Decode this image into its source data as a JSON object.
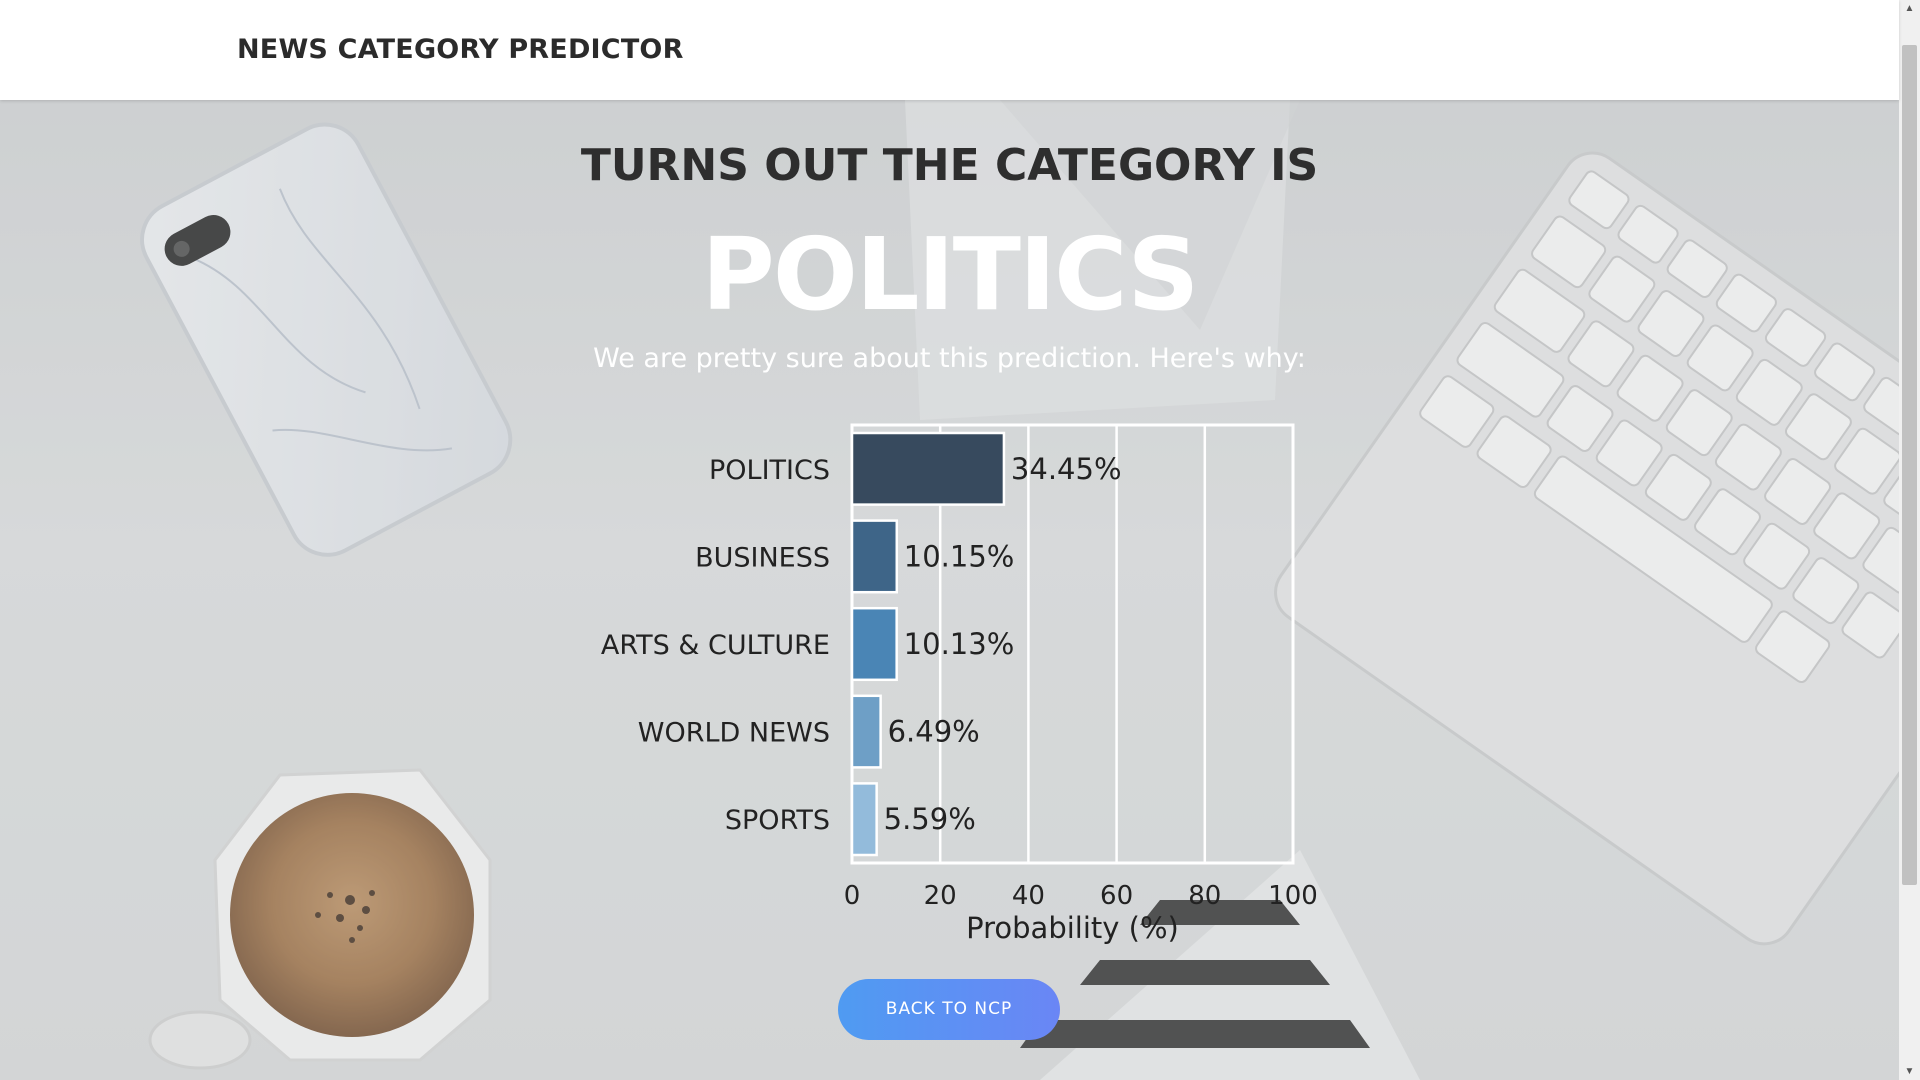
{
  "navbar": {
    "brand": "NEWS CATEGORY PREDICTOR"
  },
  "hero": {
    "headline": "TURNS OUT THE CATEGORY IS",
    "category": "POLITICS",
    "subtext": "We are pretty sure about this prediction. Here's why:"
  },
  "chart_data": {
    "type": "bar",
    "orientation": "horizontal",
    "categories": [
      "POLITICS",
      "BUSINESS",
      "ARTS & CULTURE",
      "WORLD NEWS",
      "SPORTS"
    ],
    "values": [
      34.45,
      10.15,
      10.13,
      6.49,
      5.59
    ],
    "value_labels": [
      "34.45%",
      "10.15%",
      "10.13%",
      "6.49%",
      "5.59%"
    ],
    "bar_colors": [
      "#374a5e",
      "#3e6588",
      "#4a85b5",
      "#6e9fc6",
      "#93bbdb"
    ],
    "xlabel": "Probability (%)",
    "xlim": [
      0,
      100
    ],
    "xticks": [
      0,
      20,
      40,
      60,
      80,
      100
    ],
    "grid": true
  },
  "button": {
    "label": "BACK TO NCP"
  },
  "colors": {
    "button_start": "#4f9bf2",
    "button_end": "#6a86f5",
    "headline": "#2e2e2e"
  }
}
